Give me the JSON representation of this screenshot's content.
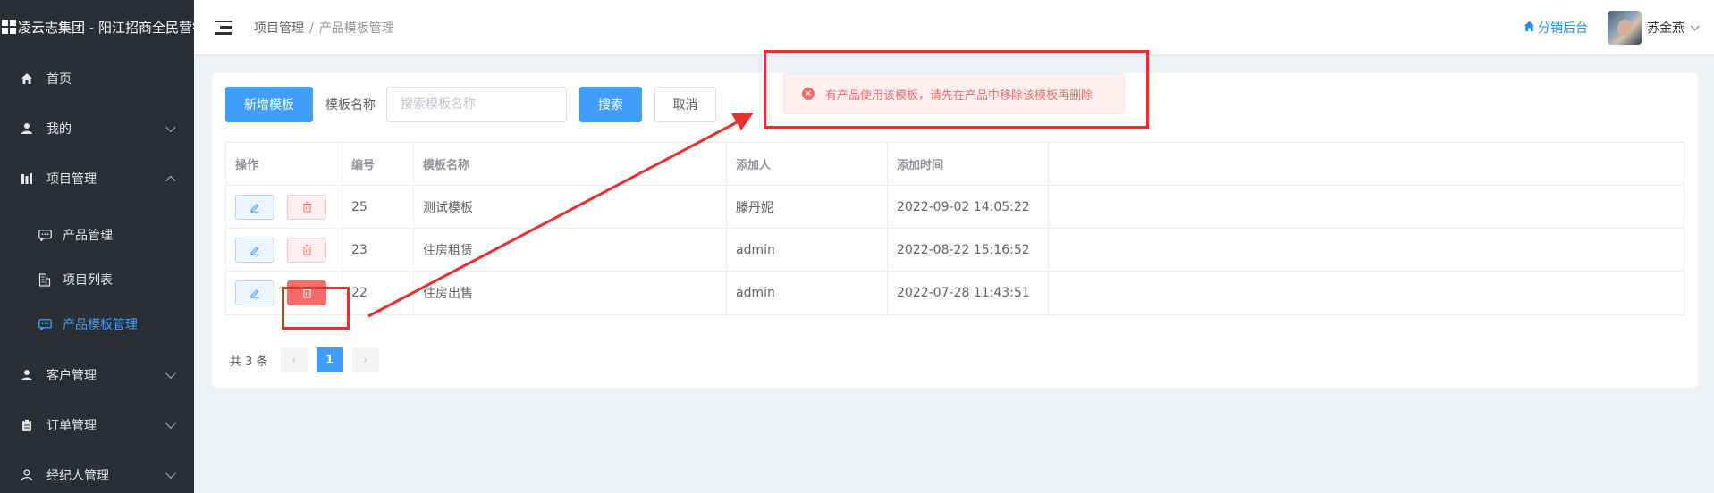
{
  "sidebar": {
    "brand": "凌云志集团 - 阳江招商全民营销",
    "menu": [
      {
        "label": "首页"
      },
      {
        "label": "我的"
      },
      {
        "label": "项目管理"
      }
    ],
    "submenu": [
      {
        "label": "产品管理"
      },
      {
        "label": "项目列表"
      },
      {
        "label": "产品模板管理"
      }
    ],
    "menu_bottom": [
      {
        "label": "客户管理"
      },
      {
        "label": "订单管理"
      },
      {
        "label": "经纪人管理"
      }
    ]
  },
  "header": {
    "breadcrumb_parent": "项目管理",
    "breadcrumb_sep": "/",
    "breadcrumb_current": "产品模板管理",
    "dist_link": "分销后台",
    "user_name": "苏金燕"
  },
  "toolbar": {
    "add_label": "新增模板",
    "field_label": "模板名称",
    "search_placeholder": "搜索模板名称",
    "search_label": "搜索",
    "cancel_label": "取消"
  },
  "table": {
    "headers": [
      "操作",
      "编号",
      "模板名称",
      "添加人",
      "添加时间"
    ],
    "rows": [
      {
        "id": "25",
        "name": "测试模板",
        "user": "滕丹妮",
        "time": "2022-09-02 14:05:22"
      },
      {
        "id": "23",
        "name": "住房租赁",
        "user": "admin",
        "time": "2022-08-22 15:16:52"
      },
      {
        "id": "22",
        "name": "住房出售",
        "user": "admin",
        "time": "2022-07-28 11:43:51"
      }
    ]
  },
  "pagination": {
    "total": "共 3 条",
    "prev": "‹",
    "page": "1",
    "next": "›"
  },
  "toast": {
    "message": "有产品使用该模板，请先在产品中移除该模板再删除"
  },
  "colors": {
    "primary": "#409eff",
    "danger": "#f56c6c",
    "sidebar_bg": "#2a2f36",
    "annotation": "#e8302b"
  }
}
